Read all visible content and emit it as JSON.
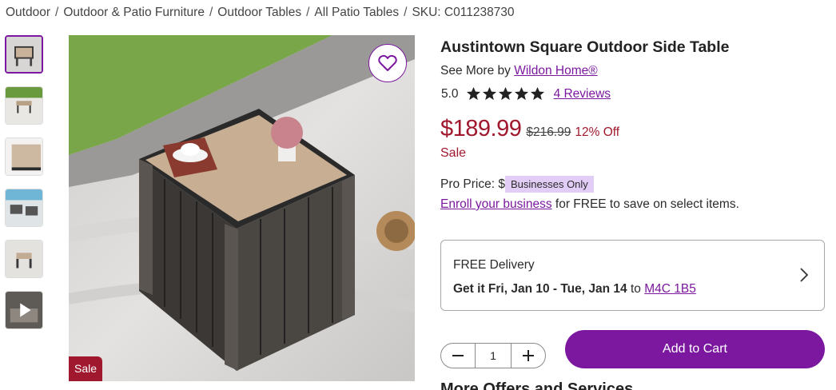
{
  "breadcrumb": {
    "items": [
      "Outdoor",
      "Outdoor & Patio Furniture",
      "Outdoor Tables",
      "All Patio Tables"
    ],
    "sku": "SKU: C011238730"
  },
  "gallery": {
    "thumbnails": [
      "product-view-1",
      "product-view-2",
      "product-view-3",
      "product-view-4",
      "product-view-5",
      "product-video"
    ],
    "active_index": 0,
    "sale_badge": "Sale"
  },
  "product": {
    "title": "Austintown Square Outdoor Side Table",
    "see_more_prefix": "See More by",
    "brand": "Wildon Home®",
    "rating": "5.0",
    "stars": 5,
    "reviews": "4 Reviews",
    "price": "$189.99",
    "was_price": "$216.99",
    "discount": "12% Off",
    "sale_label": "Sale"
  },
  "pro": {
    "label": "Pro Price: $",
    "badge": "Businesses Only",
    "enroll_link": "Enroll your business",
    "enroll_suffix": "for FREE to save on select items."
  },
  "delivery": {
    "title": "FREE Delivery",
    "window": "Get it Fri, Jan 10 - Tue, Jan 14",
    "to": "to",
    "postal": "M4C 1B5"
  },
  "cart": {
    "quantity": "1",
    "add_label": "Add to Cart"
  },
  "more_offers": "More Offers and Services",
  "colors": {
    "accent": "#7b189f",
    "sale": "#a0182e",
    "badge_bg": "#e2cdf6"
  }
}
